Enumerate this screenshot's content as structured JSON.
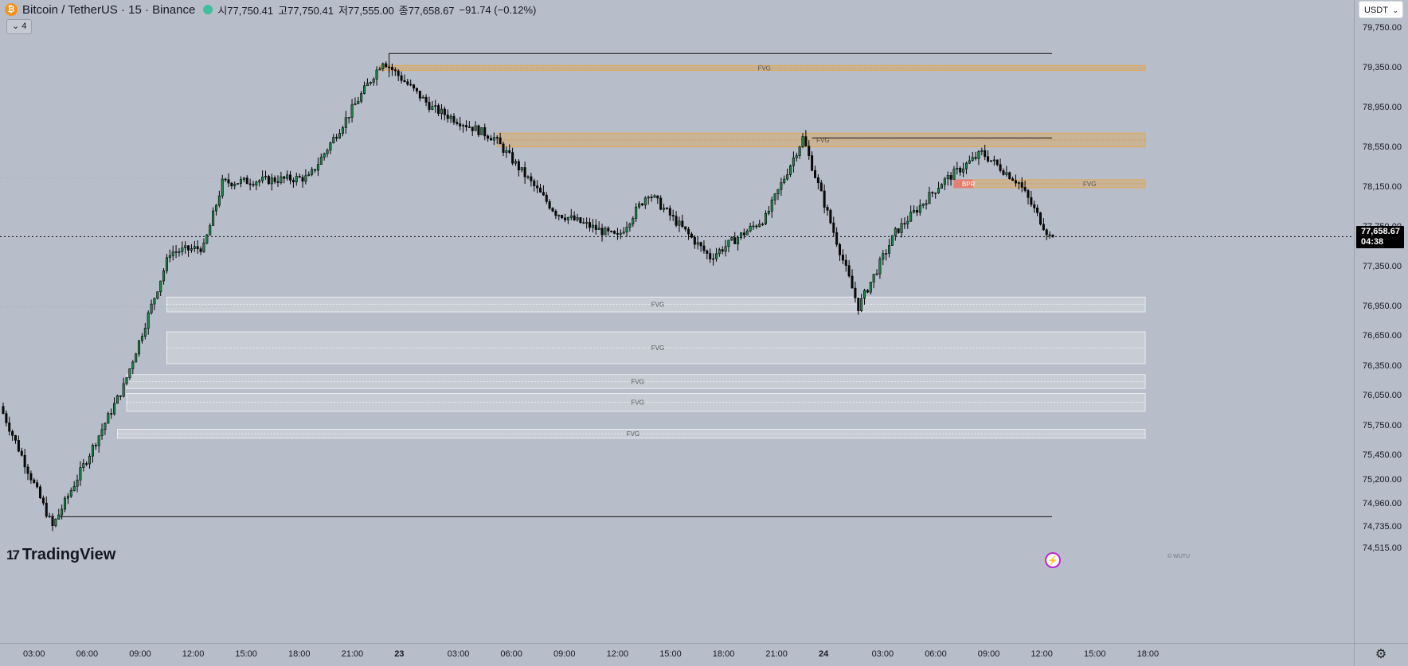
{
  "header": {
    "coin_icon_glyph": "₿",
    "symbol": "Bitcoin / TetherUS · 15 · Binance",
    "open": "시77,750.41",
    "high": "고77,750.41",
    "low": "저77,555.00",
    "close": "종77,658.67",
    "change": "−91.74 (−0.12%)",
    "change_color": "#131722",
    "indicator_toggle": "⌄ 4"
  },
  "currency_select": {
    "value": "USDT"
  },
  "logo": {
    "mark": "17",
    "text": "TradingView"
  },
  "watermark": "© WUTU",
  "bolt_icon": "⚡",
  "gear_icon": "⚙",
  "price_tag": {
    "price": "77,658.67",
    "countdown": "04:38"
  },
  "colors": {
    "bull": "#1e8a4a",
    "bear": "#0b0b0b",
    "background": "#b8bec9",
    "fvg_orange": "#e8a33c",
    "fvg_white": "#e6e8ec",
    "bpr": "#e8776b"
  },
  "chart_data": {
    "type": "candlestick",
    "interval": "15m",
    "x_labels": [
      "03:00",
      "06:00",
      "09:00",
      "12:00",
      "15:00",
      "18:00",
      "21:00",
      "23",
      "03:00",
      "06:00",
      "09:00",
      "12:00",
      "15:00",
      "18:00",
      "21:00",
      "24",
      "03:00",
      "06:00",
      "09:00",
      "12:00",
      "15:00",
      "18:00"
    ],
    "y_ticks": [
      "79,750.00",
      "79,350.00",
      "78,950.00",
      "78,550.00",
      "78,150.00",
      "77,750.00",
      "77,350.00",
      "76,950.00",
      "76,650.00",
      "76,350.00",
      "76,050.00",
      "75,750.00",
      "75,450.00",
      "75,200.00",
      "74,960.00",
      "74,735.00",
      "74,515.00"
    ],
    "last_price": 77658.67,
    "key_points": [
      {
        "t": 0,
        "price": 75950,
        "label": "start"
      },
      {
        "t": 17,
        "price": 74740,
        "label": "low"
      },
      {
        "t": 40,
        "price": 76150,
        "label": ""
      },
      {
        "t": 55,
        "price": 77500,
        "label": ""
      },
      {
        "t": 66,
        "price": 77550,
        "label": ""
      },
      {
        "t": 72,
        "price": 78200,
        "label": ""
      },
      {
        "t": 100,
        "price": 78250,
        "label": ""
      },
      {
        "t": 124,
        "price": 79430,
        "label": "high"
      },
      {
        "t": 140,
        "price": 78950,
        "label": ""
      },
      {
        "t": 160,
        "price": 78650,
        "label": ""
      },
      {
        "t": 180,
        "price": 77900,
        "label": ""
      },
      {
        "t": 200,
        "price": 77650,
        "label": ""
      },
      {
        "t": 210,
        "price": 78100,
        "label": ""
      },
      {
        "t": 230,
        "price": 77450,
        "label": ""
      },
      {
        "t": 248,
        "price": 77850,
        "label": ""
      },
      {
        "t": 260,
        "price": 78650,
        "label": ""
      },
      {
        "t": 278,
        "price": 76950,
        "label": ""
      },
      {
        "t": 290,
        "price": 77700,
        "label": ""
      },
      {
        "t": 305,
        "price": 78200,
        "label": ""
      },
      {
        "t": 318,
        "price": 78500,
        "label": ""
      },
      {
        "t": 330,
        "price": 78200,
        "label": ""
      },
      {
        "t": 340,
        "price": 77658,
        "label": "last"
      }
    ],
    "zones": [
      {
        "label": "FVG",
        "top": 79380,
        "bottom": 79330,
        "style": "orange",
        "t_start": 122
      },
      {
        "label": "FVG",
        "top": 78700,
        "bottom": 78560,
        "style": "orange",
        "t_start": 160
      },
      {
        "label": "FVG",
        "top": 78230,
        "bottom": 78150,
        "style": "orange",
        "t_start": 310
      },
      {
        "label": "BPR",
        "top": 78230,
        "bottom": 78150,
        "style": "bpr",
        "t_start": 308
      },
      {
        "label": "FVG",
        "top": 77050,
        "bottom": 76900,
        "style": "white",
        "t_start": 53
      },
      {
        "label": "FVG",
        "top": 76700,
        "bottom": 76380,
        "style": "white",
        "t_start": 53
      },
      {
        "label": "FVG",
        "top": 76270,
        "bottom": 76130,
        "style": "white",
        "t_start": 40
      },
      {
        "label": "FVG",
        "top": 76080,
        "bottom": 75900,
        "style": "white",
        "t_start": 40
      },
      {
        "label": "FVG",
        "top": 75720,
        "bottom": 75630,
        "style": "white",
        "t_start": 37
      }
    ],
    "lines": [
      {
        "name": "range-high-line",
        "price": 79500
      },
      {
        "name": "range-low-line",
        "price": 74840
      },
      {
        "name": "session-high-line",
        "price": 78650
      },
      {
        "name": "last-price-line",
        "price": 77658
      }
    ]
  }
}
